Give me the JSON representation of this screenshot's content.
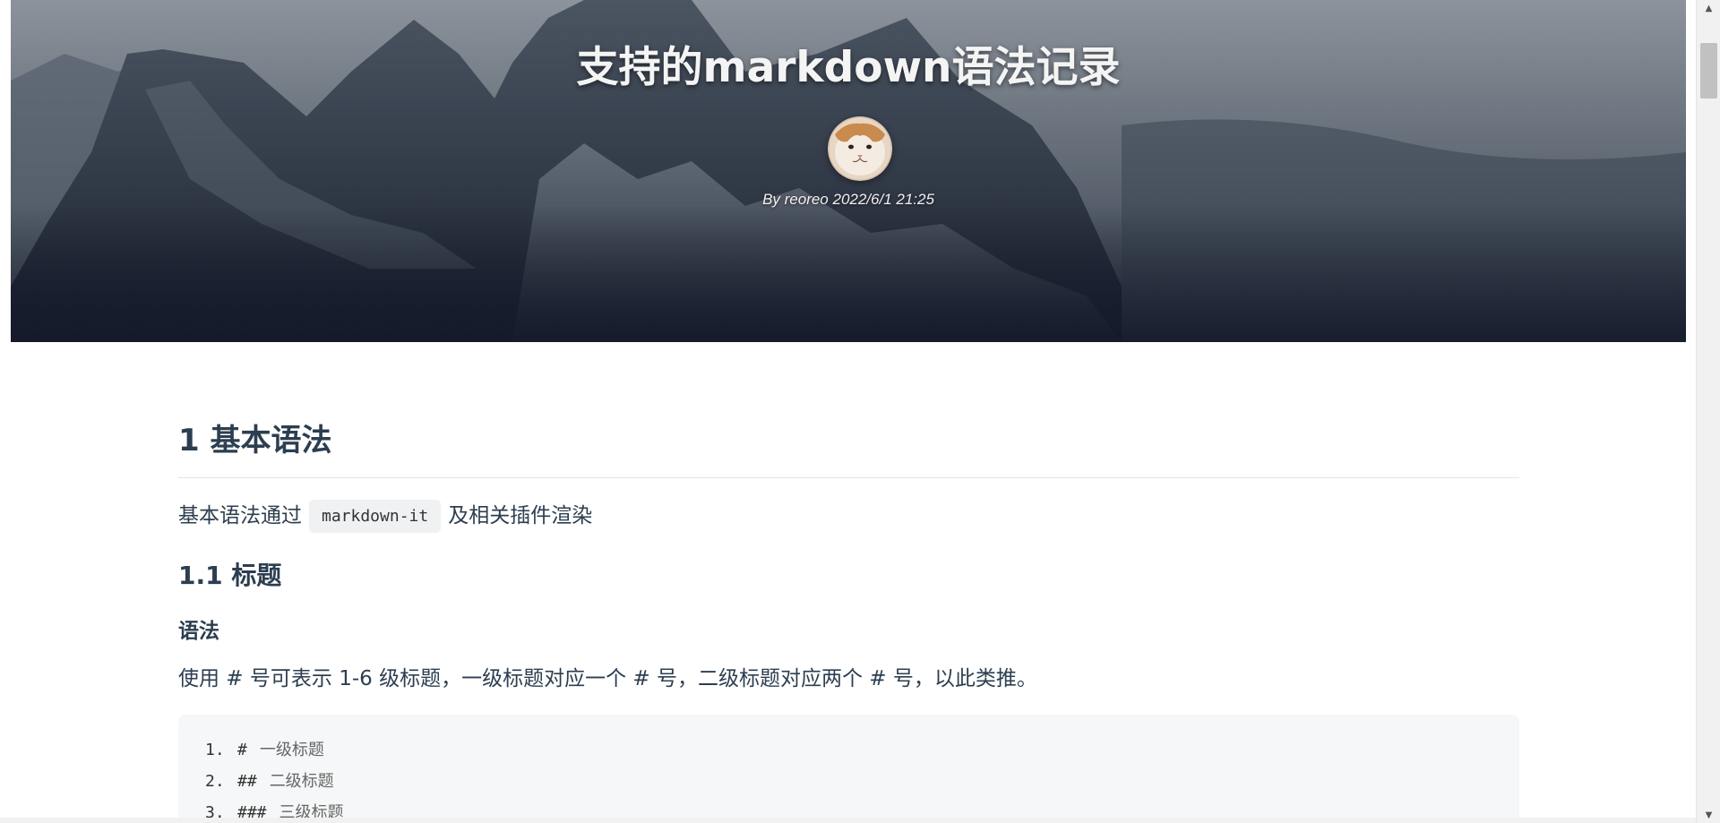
{
  "hero": {
    "title": "支持的markdown语法记录",
    "byline": "By reoreo 2022/6/1 21:25",
    "avatar_icon": "cat-avatar-icon"
  },
  "article": {
    "h1": "1 基本语法",
    "intro_before": "基本语法通过",
    "intro_code": "markdown-it",
    "intro_after": "及相关插件渲染",
    "h2": "1.1 标题",
    "h4": "语法",
    "desc": "使用 # 号可表示 1-6 级标题，一级标题对应一个 # 号，二级标题对应两个 # 号，以此类推。",
    "code_lines": [
      {
        "num": "1.",
        "hash": "#",
        "text": "一级标题"
      },
      {
        "num": "2.",
        "hash": "##",
        "text": "二级标题"
      },
      {
        "num": "3.",
        "hash": "###",
        "text": "三级标题"
      }
    ]
  },
  "scrollbar": {
    "up_icon": "arrow-up-icon",
    "down_icon": "arrow-down-icon"
  }
}
